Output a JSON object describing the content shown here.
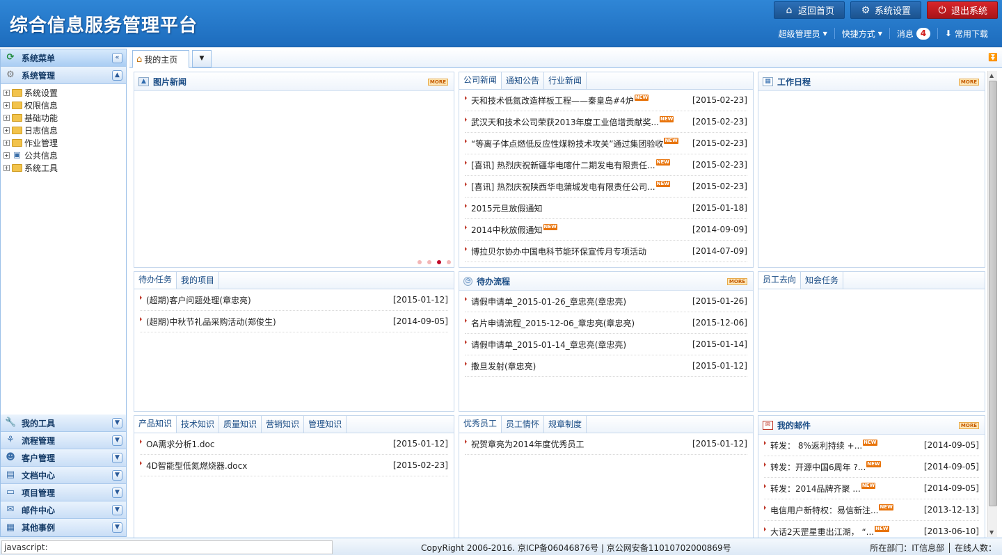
{
  "header": {
    "title": "综合信息服务管理平台",
    "buttons": {
      "home": "返回首页",
      "settings": "系统设置",
      "exit": "退出系统"
    },
    "user": "超级管理员",
    "shortcut": "快捷方式",
    "messages_label": "消息",
    "messages_count": "4",
    "download": "常用下载"
  },
  "sidebar": {
    "menu_title": "系统菜单",
    "section_title": "系统管理",
    "tree": [
      {
        "label": "系统设置"
      },
      {
        "label": "权限信息"
      },
      {
        "label": "基础功能"
      },
      {
        "label": "日志信息"
      },
      {
        "label": "作业管理"
      },
      {
        "label": "公共信息"
      },
      {
        "label": "系统工具"
      }
    ],
    "sections": [
      {
        "label": "我的工具",
        "icon": "wrench-icon"
      },
      {
        "label": "流程管理",
        "icon": "flow-icon"
      },
      {
        "label": "客户管理",
        "icon": "customers-icon"
      },
      {
        "label": "文档中心",
        "icon": "document-icon"
      },
      {
        "label": "项目管理",
        "icon": "project-icon"
      },
      {
        "label": "邮件中心",
        "icon": "mail-icon"
      },
      {
        "label": "其他事例",
        "icon": "other-icon"
      }
    ]
  },
  "tabs": {
    "home": "我的主页"
  },
  "panels": {
    "photo_news": {
      "title": "图片新闻",
      "more": "MORE"
    },
    "company_news": {
      "tabs": [
        "公司新闻",
        "通知公告",
        "行业新闻"
      ],
      "items": [
        {
          "text": "天和技术低氮改造样板工程——秦皇岛#4炉",
          "new": "NEW",
          "date": "[2015-02-23]"
        },
        {
          "text": "武汉天和技术公司荣获2013年度工业倍增贡献奖...",
          "new": "NEW",
          "date": "[2015-02-23]"
        },
        {
          "text": "“等离子体点燃低反应性煤粉技术攻关”通过集团验收",
          "new": "NEW",
          "date": "[2015-02-23]"
        },
        {
          "text": "[喜讯] 热烈庆祝新疆华电喀什二期发电有限责任...",
          "new": "NEW",
          "date": "[2015-02-23]"
        },
        {
          "text": "[喜讯] 热烈庆祝陕西华电蒲城发电有限责任公司...",
          "new": "NEW",
          "date": "[2015-02-23]"
        },
        {
          "text": "2015元旦放假通知",
          "new": "",
          "date": "[2015-01-18]"
        },
        {
          "text": "2014中秋放假通知",
          "new": "NEW",
          "date": "[2014-09-09]"
        },
        {
          "text": "博拉贝尔协办中国电科节能环保宣传月专项活动",
          "new": "",
          "date": "[2014-07-09]"
        }
      ]
    },
    "schedule": {
      "title": "工作日程",
      "more": "MORE"
    },
    "todo": {
      "tabs": [
        "待办任务",
        "我的项目"
      ],
      "items": [
        {
          "text": "(超期)客户问题处理(章忠亮)",
          "date": "[2015-01-12]"
        },
        {
          "text": "(超期)中秋节礼品采购活动(郑俊生)",
          "date": "[2014-09-05]"
        }
      ]
    },
    "flow": {
      "title": "待办流程",
      "more": "MORE",
      "items": [
        {
          "text": "请假申请单_2015-01-26_章忠亮(章忠亮)",
          "date": "[2015-01-26]"
        },
        {
          "text": "名片申请流程_2015-12-06_章忠亮(章忠亮)",
          "date": "[2015-12-06]"
        },
        {
          "text": "请假申请单_2015-01-14_章忠亮(章忠亮)",
          "date": "[2015-01-14]"
        },
        {
          "text": "撒旦发射(章忠亮)",
          "date": "[2015-01-12]"
        }
      ]
    },
    "staff": {
      "tabs": [
        "员工去向",
        "知会任务"
      ]
    },
    "knowledge": {
      "tabs": [
        "产品知识",
        "技术知识",
        "质量知识",
        "营销知识",
        "管理知识"
      ],
      "items": [
        {
          "text": "OA需求分析1.doc",
          "date": "[2015-01-12]"
        },
        {
          "text": "4D智能型低氮燃烧器.docx",
          "date": "[2015-02-23]"
        }
      ]
    },
    "excellent": {
      "tabs": [
        "优秀员工",
        "员工情怀",
        "规章制度"
      ],
      "items": [
        {
          "text": "祝贺章亮为2014年度优秀员工",
          "date": "[2015-01-12]"
        }
      ]
    },
    "mail": {
      "title": "我的邮件",
      "more": "MORE",
      "items": [
        {
          "text": "转发： 8%返利持续 +...",
          "new": "NEW",
          "date": "[2014-09-05]"
        },
        {
          "text": "转发：开源中国6周年 ?...",
          "new": "NEW",
          "date": "[2014-09-05]"
        },
        {
          "text": "转发：2014品牌齐聚 ...",
          "new": "NEW",
          "date": "[2014-09-05]"
        },
        {
          "text": "电信用户新特权：易信新注...",
          "new": "NEW",
          "date": "[2013-12-13]"
        },
        {
          "text": "大话2天罡星重出江湖， “...",
          "new": "NEW",
          "date": "[2013-06-10]"
        }
      ]
    }
  },
  "status": {
    "js": "javascript:",
    "copyright": "CopyRight 2006-2016. 京ICP备06046876号 | 京公网安备11010702000869号",
    "dept": "所在部门：IT信息部 │ 在线人数："
  }
}
